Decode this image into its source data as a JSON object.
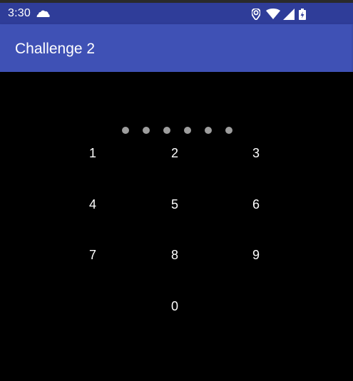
{
  "status_bar": {
    "time": "3:30",
    "icons": [
      "cloud-icon",
      "location-icon",
      "wifi-icon",
      "signal-icon",
      "battery-charging-icon"
    ],
    "background_color": "#2f3d99"
  },
  "app_bar": {
    "title": "Challenge 2",
    "background_color": "#3f51b5"
  },
  "pin": {
    "dot_count": 6,
    "dot_color": "#9e9e9e"
  },
  "keypad": {
    "keys": [
      "1",
      "2",
      "3",
      "4",
      "5",
      "6",
      "7",
      "8",
      "9",
      "0"
    ]
  }
}
